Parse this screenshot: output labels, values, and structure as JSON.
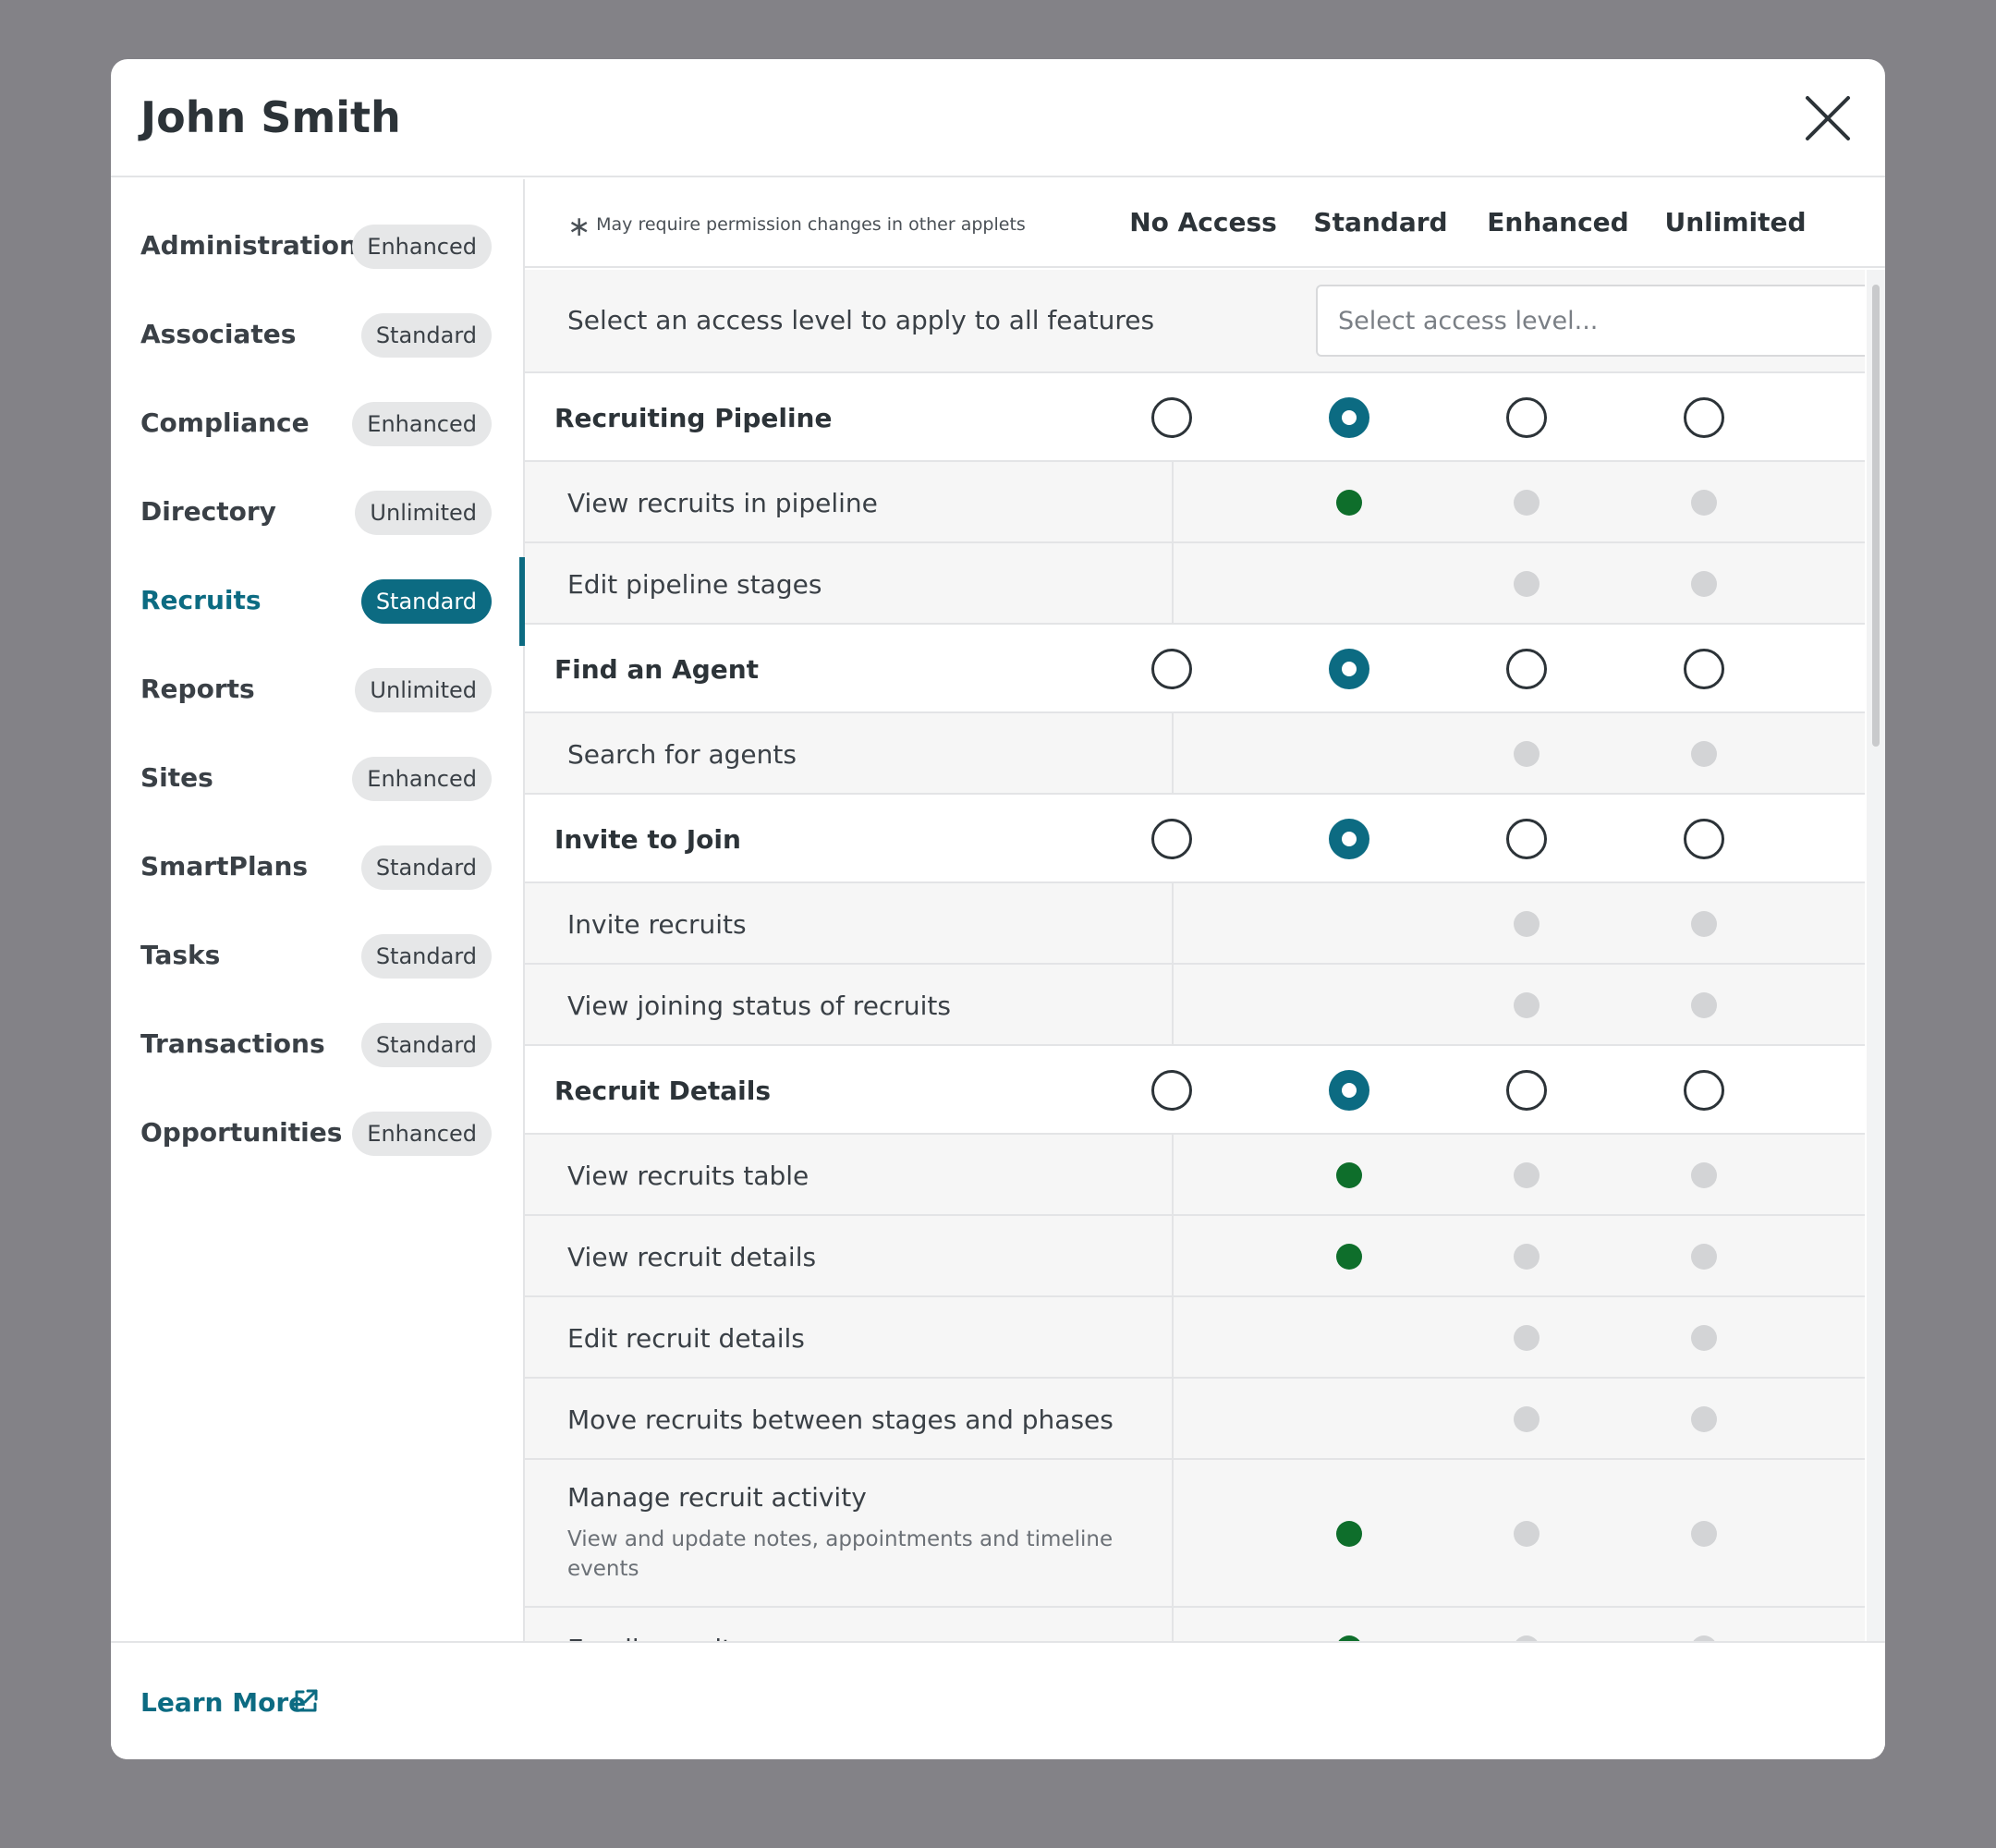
{
  "modal": {
    "title": "John Smith"
  },
  "sidebar": {
    "items": [
      {
        "label": "Administration",
        "badge": "Enhanced"
      },
      {
        "label": "Associates",
        "badge": "Standard"
      },
      {
        "label": "Compliance",
        "badge": "Enhanced"
      },
      {
        "label": "Directory",
        "badge": "Unlimited"
      },
      {
        "label": "Recruits",
        "badge": "Standard",
        "active": true
      },
      {
        "label": "Reports",
        "badge": "Unlimited"
      },
      {
        "label": "Sites",
        "badge": "Enhanced"
      },
      {
        "label": "SmartPlans",
        "badge": "Standard"
      },
      {
        "label": "Tasks",
        "badge": "Standard"
      },
      {
        "label": "Transactions",
        "badge": "Standard"
      },
      {
        "label": "Opportunities",
        "badge": "Enhanced"
      }
    ]
  },
  "header": {
    "note": "May require permission changes in other applets",
    "columns": [
      "No Access",
      "Standard",
      "Enhanced",
      "Unlimited"
    ]
  },
  "apply_all": {
    "label": "Select an access level to apply to all features",
    "placeholder": "Select access level..."
  },
  "groups": [
    {
      "name": "Recruiting Pipeline",
      "selected": 1,
      "features": [
        {
          "label": "View recruits in pipeline",
          "levels": [
            null,
            true,
            false,
            false
          ]
        },
        {
          "label": "Edit pipeline stages",
          "levels": [
            null,
            null,
            false,
            false
          ]
        }
      ]
    },
    {
      "name": "Find an Agent",
      "selected": 1,
      "features": [
        {
          "label": "Search for agents",
          "levels": [
            null,
            null,
            false,
            false
          ]
        }
      ]
    },
    {
      "name": "Invite to Join",
      "selected": 1,
      "features": [
        {
          "label": "Invite recruits",
          "levels": [
            null,
            null,
            false,
            false
          ]
        },
        {
          "label": "View joining status of recruits",
          "levels": [
            null,
            null,
            false,
            false
          ]
        }
      ]
    },
    {
      "name": "Recruit Details",
      "selected": 1,
      "features": [
        {
          "label": "View recruits table",
          "levels": [
            null,
            true,
            false,
            false
          ]
        },
        {
          "label": "View recruit details",
          "levels": [
            null,
            true,
            false,
            false
          ]
        },
        {
          "label": "Edit recruit details",
          "levels": [
            null,
            null,
            false,
            false
          ]
        },
        {
          "label": "Move recruits between stages and phases",
          "levels": [
            null,
            null,
            false,
            false
          ]
        },
        {
          "label": "Manage recruit activity",
          "sub": "View and update notes, appointments and timeline events",
          "levels": [
            null,
            true,
            false,
            false
          ]
        },
        {
          "label": "Email recruits",
          "levels": [
            null,
            true,
            false,
            false
          ]
        }
      ]
    }
  ],
  "footer": {
    "learn_more": "Learn More"
  },
  "colors": {
    "accent": "#0c6b82",
    "granted": "#0e6e2b",
    "not_granted": "#d3d4d6"
  }
}
